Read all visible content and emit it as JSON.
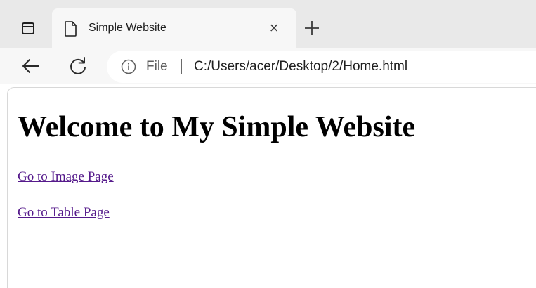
{
  "browser": {
    "tab": {
      "title": "Simple Website",
      "close_glyph": "×"
    },
    "address_bar": {
      "scheme_label": "File",
      "url": "C:/Users/acer/Desktop/2/Home.html"
    },
    "icons": [
      "sidebar-toggle-icon",
      "page-icon",
      "close-icon",
      "plus-icon",
      "back-arrow-icon",
      "reload-icon",
      "info-icon"
    ]
  },
  "page": {
    "heading": "Welcome to My Simple Website",
    "links": [
      {
        "label": "Go to Image Page"
      },
      {
        "label": "Go to Table Page"
      }
    ]
  },
  "colors": {
    "visited_link": "#551a8b",
    "tabstrip_bg": "#e9e9e9",
    "toolbar_bg": "#f7f7f7"
  }
}
